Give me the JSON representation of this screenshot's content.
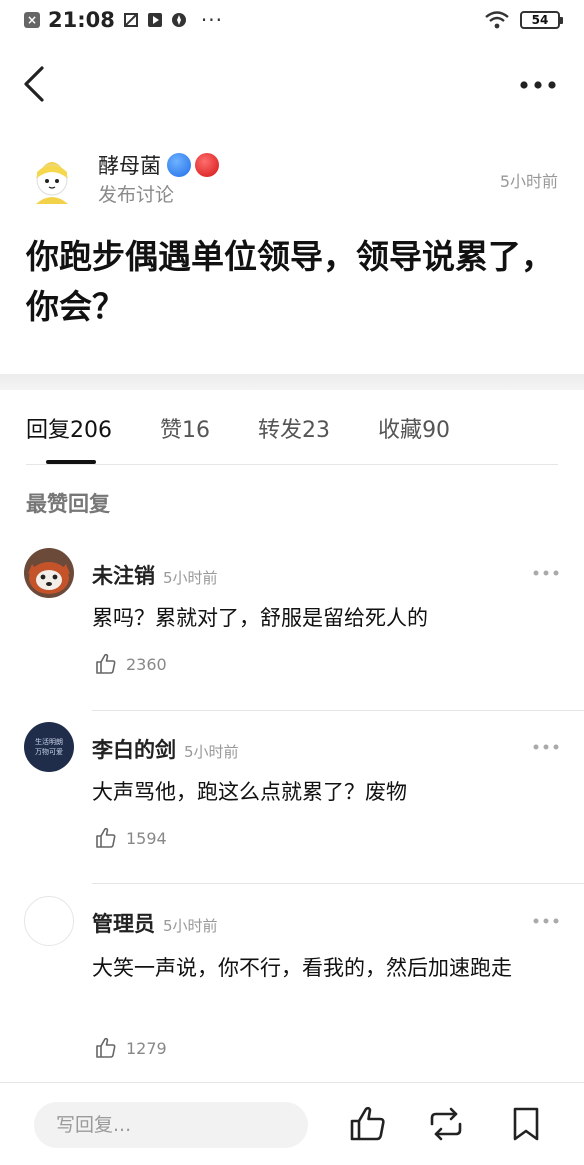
{
  "status_bar": {
    "time": "21:08",
    "dots": "···",
    "battery": "54"
  },
  "post": {
    "username": "酵母菌",
    "subtitle": "发布讨论",
    "time": "5小时前",
    "title": "你跑步偶遇单位领导，领导说累了，你会？"
  },
  "tabs": [
    {
      "label": "回复",
      "count": "206"
    },
    {
      "label": "赞",
      "count": "16"
    },
    {
      "label": "转发",
      "count": "23"
    },
    {
      "label": "收藏",
      "count": "90"
    }
  ],
  "section_title": "最赞回复",
  "comments": [
    {
      "name": "未注销",
      "time": "5小时前",
      "text": "累吗？累就对了，舒服是留给死人的",
      "likes": "2360"
    },
    {
      "name": "李白的剑",
      "time": "5小时前",
      "text": "大声骂他，跑这么点就累了？废物",
      "likes": "1594",
      "avatar_text": [
        "生活明朗",
        "万物可爱"
      ]
    },
    {
      "name": "管理员",
      "time": "5小时前",
      "text": "大笑一声说，你不行，看我的，然后加速跑走",
      "likes": "1279"
    }
  ],
  "bottom_bar": {
    "reply_placeholder": "写回复..."
  },
  "colors": {
    "accent": "#111111",
    "badge_blue": "#1f6ee8",
    "badge_red": "#d21414"
  }
}
